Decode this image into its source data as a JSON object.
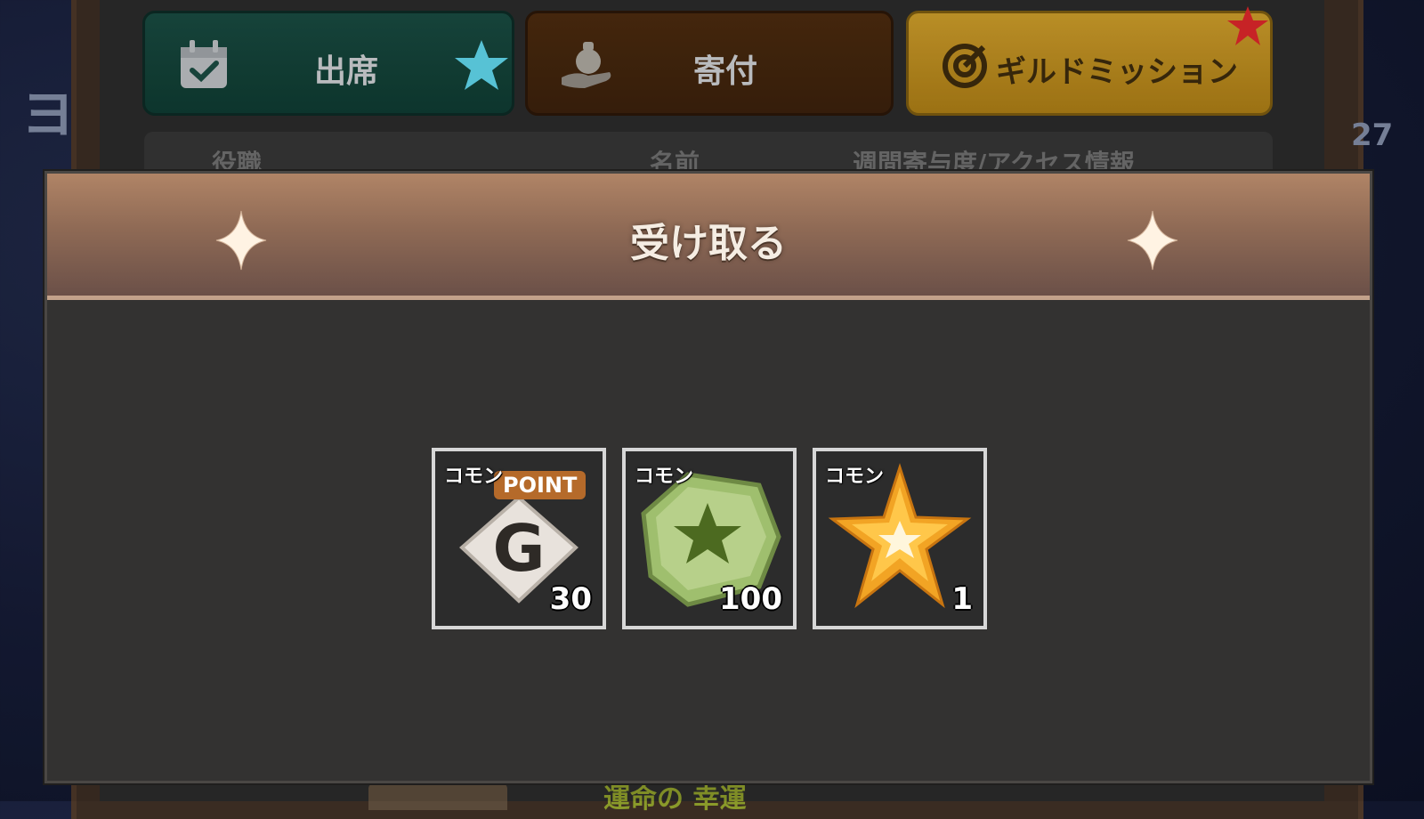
{
  "background": {
    "tabs": [
      {
        "id": "attendance",
        "label": "出席",
        "icon": "calendar-check-icon"
      },
      {
        "id": "donation",
        "label": "寄付",
        "icon": "money-bag-hand-icon"
      },
      {
        "id": "guild_mission",
        "label": "ギルドミッション",
        "icon": "target-icon"
      }
    ],
    "table_header": {
      "role": "役職",
      "name": "名前",
      "info": "週間寄与度/アクセス情報"
    },
    "side_number": "27",
    "bottom_text": "運命の 幸運"
  },
  "modal": {
    "title": "受け取る",
    "items": [
      {
        "rarity": "コモン",
        "badge": "POINT",
        "icon": "guild-point-g-icon",
        "quantity": "30"
      },
      {
        "rarity": "コモン",
        "icon": "green-star-gem-icon",
        "quantity": "100"
      },
      {
        "rarity": "コモン",
        "icon": "gold-star-icon",
        "quantity": "1"
      }
    ]
  },
  "colors": {
    "attendance_tab": "#0f3a31",
    "donation_tab": "#3a200c",
    "mission_tab": "#c99a2a",
    "modal_header": "#8f6a55",
    "modal_body": "#333231",
    "item_border": "#d7d7d7"
  }
}
